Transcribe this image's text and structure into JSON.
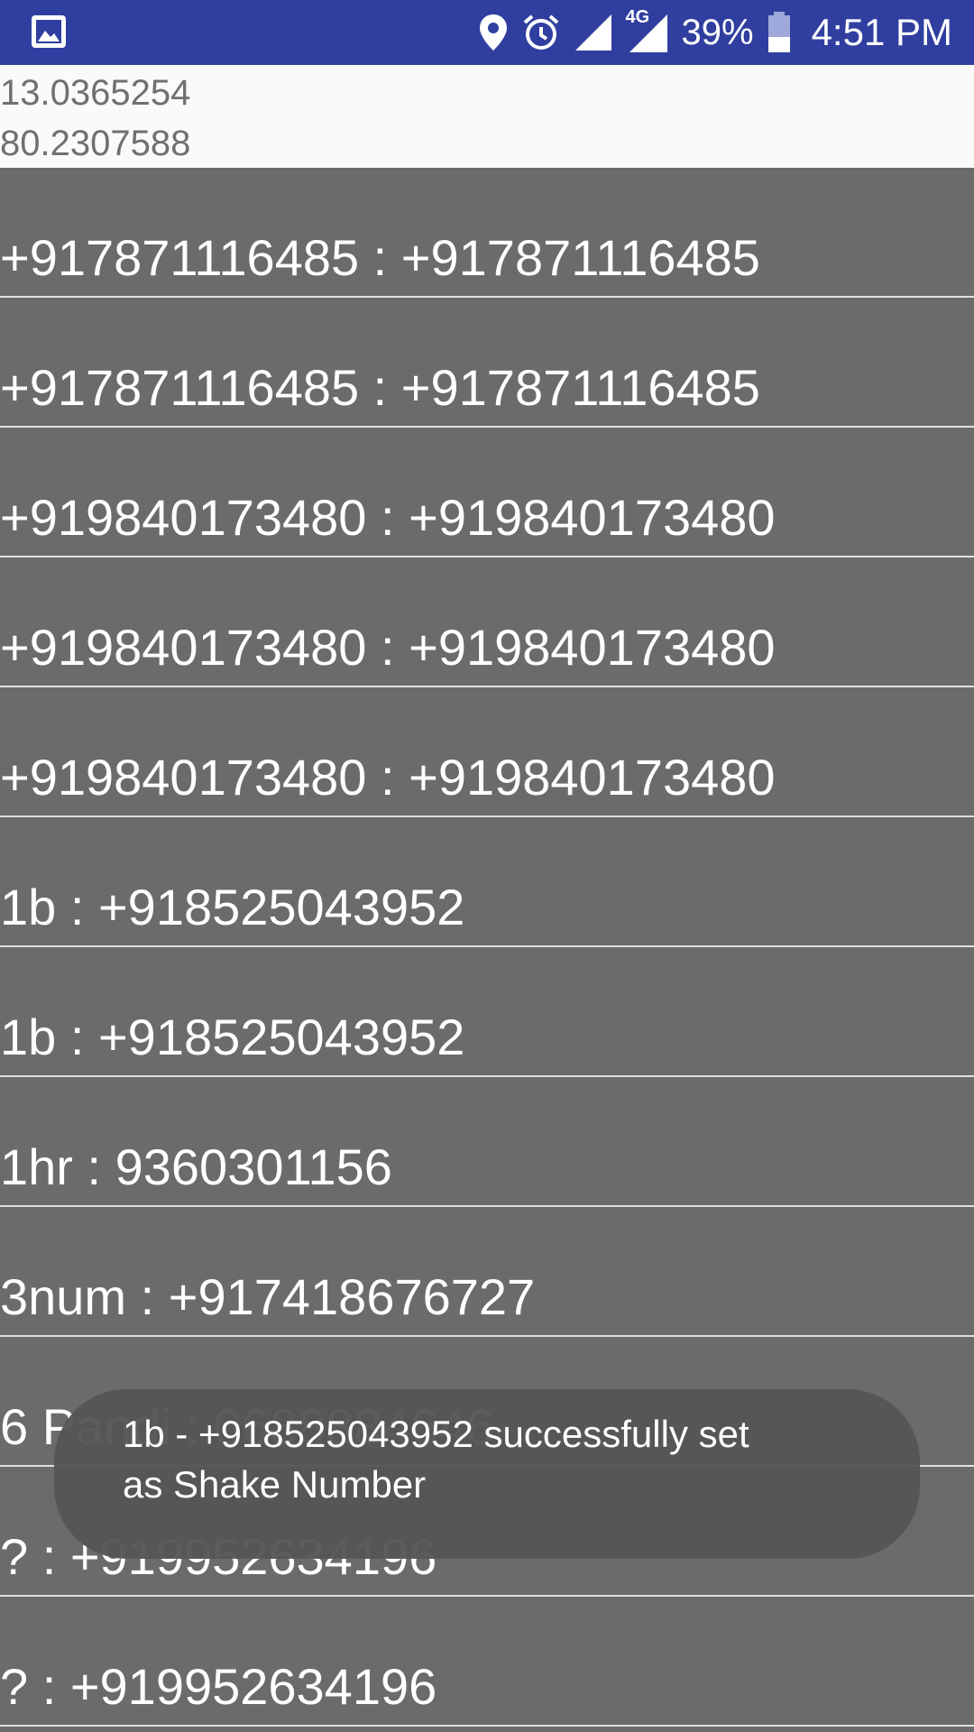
{
  "status_bar": {
    "battery_percent": "39%",
    "time": "4:51 PM",
    "network_type": "4G",
    "icons": [
      "gallery-icon",
      "location-icon",
      "alarm-icon",
      "signal-icon",
      "signal-4g-icon",
      "battery-icon"
    ],
    "background_color": "#303f9f"
  },
  "location": {
    "latitude": "13.0365254",
    "longitude": "80.2307588"
  },
  "contacts": [
    {
      "text": "+917871116485 : +917871116485"
    },
    {
      "text": "+917871116485 : +917871116485"
    },
    {
      "text": "+919840173480 : +919840173480"
    },
    {
      "text": "+919840173480 : +919840173480"
    },
    {
      "text": "+919840173480 : +919840173480"
    },
    {
      "text": "1b : +918525043952"
    },
    {
      "text": "1b : +918525043952"
    },
    {
      "text": "1hr : 9360301156"
    },
    {
      "text": "3num : +917418676727"
    },
    {
      "text": "6 Pandi : 0688884646"
    },
    {
      "text": "? : +919952634196"
    },
    {
      "text": "? : +919952634196"
    }
  ],
  "toast": {
    "message": "1b  - +918525043952 successfully set\nas Shake Number"
  },
  "colors": {
    "list_background": "#6b6b6b",
    "divider": "#e0e0e0",
    "coords_background": "#fafafa",
    "coords_text": "#707070",
    "toast_background": "#555555"
  }
}
